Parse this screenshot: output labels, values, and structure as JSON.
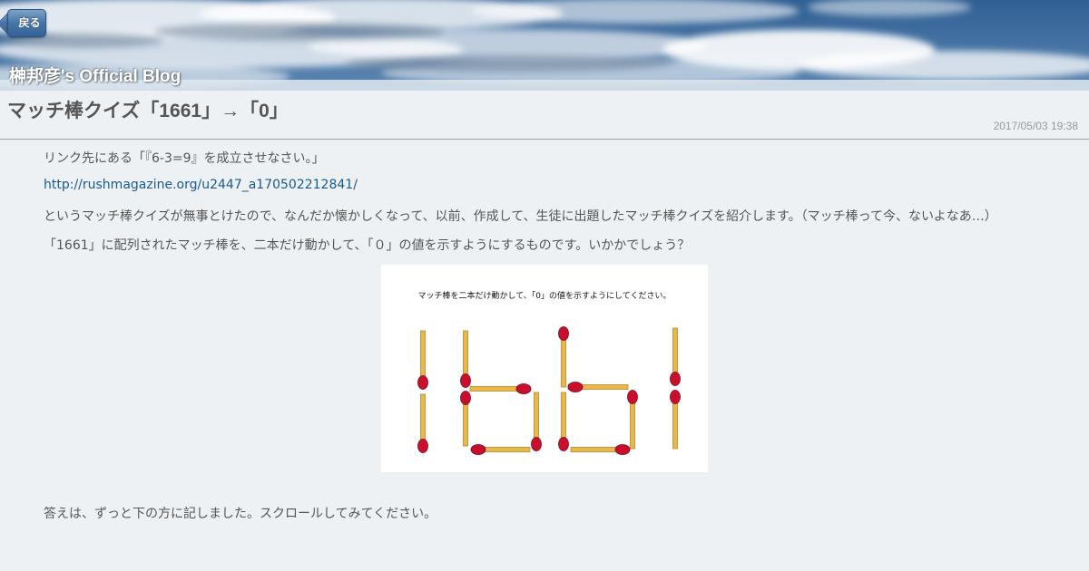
{
  "header": {
    "back_label": "戻る",
    "blog_title": "榊邦彦's Official Blog"
  },
  "post": {
    "title": "マッチ棒クイズ「1661」→「0」",
    "date": "2017/05/03 19:38",
    "paragraphs": {
      "p1": "リンク先にある「『6-3=9』を成立させなさい。」",
      "link": "http://rushmagazine.org/u2447_a170502212841/",
      "p2": "というマッチ棒クイズが無事とけたので、なんだか懐かしくなって、以前、作成して、生徒に出題したマッチ棒クイズを紹介します。（マッチ棒って今、ないよなあ…）",
      "p3": "「1661」に配列されたマッチ棒を、二本だけ動かして、「０」の値を示すようにするものです。いかかでしょう？",
      "p4": "答えは、ずっと下の方に記しました。スクロールしてみてください。"
    },
    "image": {
      "caption": "マッチ棒を二本だけ動かして、「0」の値を示すようにしてください。",
      "match_colors": {
        "stick": "#e8b84a",
        "stick_edge": "#b8862a",
        "head": "#c8102e"
      }
    }
  }
}
